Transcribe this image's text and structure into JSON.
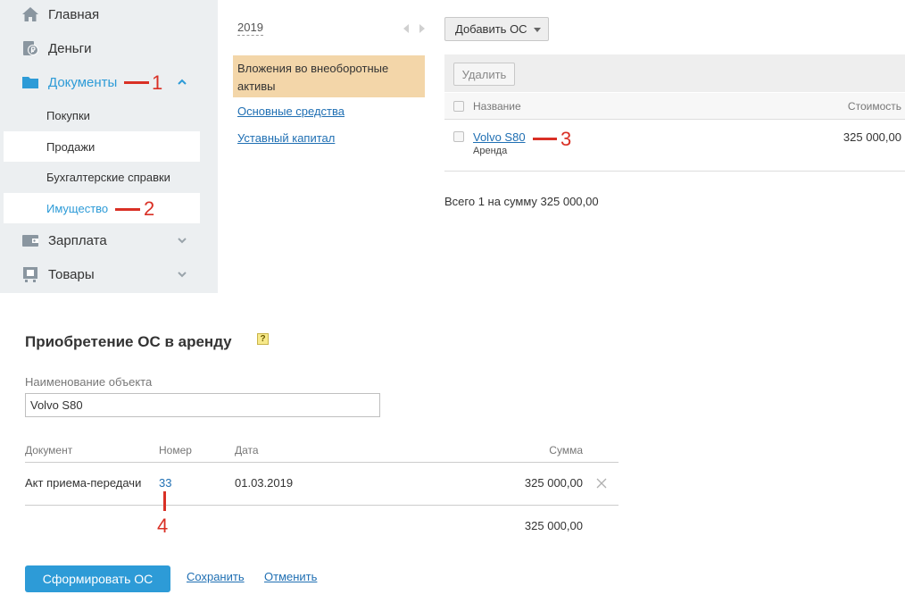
{
  "sidebar": {
    "items": [
      {
        "label": "Главная",
        "icon": "home-icon"
      },
      {
        "label": "Деньги",
        "icon": "money-icon"
      },
      {
        "label": "Документы",
        "icon": "folder-icon"
      },
      {
        "label": "Зарплата",
        "icon": "wallet-icon"
      },
      {
        "label": "Товары",
        "icon": "cart-icon"
      }
    ],
    "sub_items": [
      "Покупки",
      "Продажи",
      "Бухгалтерские справки",
      "Имущество"
    ]
  },
  "annotations": [
    "1",
    "2",
    "3",
    "4"
  ],
  "middle": {
    "year": "2019",
    "active_category": "Вложения во внеоборотные активы",
    "categories": [
      "Основные средства",
      "Уставный капитал"
    ]
  },
  "right": {
    "add_button": "Добавить ОС",
    "delete_button": "Удалить",
    "columns": {
      "name": "Название",
      "cost": "Стоимость"
    },
    "rows": [
      {
        "name": "Volvo S80",
        "sub": "Аренда",
        "cost": "325 000,00"
      }
    ],
    "total": "Всего 1 на сумму 325 000,00"
  },
  "form": {
    "title": "Приобретение ОС в аренду",
    "help": "?",
    "field_label": "Наименование объекта",
    "field_value": "Volvo S80",
    "table_headers": {
      "doc": "Документ",
      "num": "Номер",
      "date": "Дата",
      "sum": "Сумма"
    },
    "row": {
      "doc": "Акт приема-передачи",
      "num": "33",
      "date": "01.03.2019",
      "sum": "325 000,00"
    },
    "total": "325 000,00",
    "submit_button": "Сформировать ОС",
    "save_link": "Сохранить",
    "cancel_link": "Отменить"
  },
  "colors": {
    "accent": "#2d9bd7",
    "link": "#1f6fb3",
    "highlight": "#f3d6a9",
    "annotation": "#d93025"
  }
}
